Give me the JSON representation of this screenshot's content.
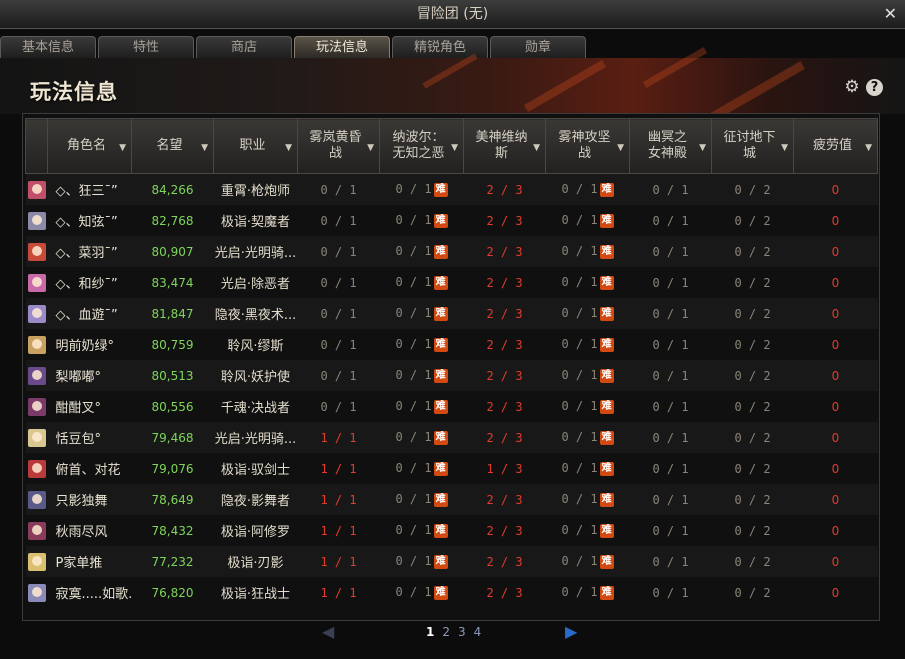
{
  "window": {
    "title": "冒险团 (无)",
    "close_glyph": "✕"
  },
  "tabs": [
    {
      "label": "基本信息",
      "active": false
    },
    {
      "label": "特性",
      "active": false
    },
    {
      "label": "商店",
      "active": false
    },
    {
      "label": "玩法信息",
      "active": true
    },
    {
      "label": "精锐角色",
      "active": false
    },
    {
      "label": "勋章",
      "active": false
    }
  ],
  "section": {
    "title": "玩法信息",
    "gear_icon": "⚙",
    "help_icon": "?"
  },
  "columns": [
    {
      "label": "",
      "sortable": false
    },
    {
      "label": "角色名",
      "sortable": true
    },
    {
      "label": "名望",
      "sortable": true
    },
    {
      "label": "职业",
      "sortable": true
    },
    {
      "label": "雾岚黄昏\n战",
      "sortable": true
    },
    {
      "label": "纳波尔：\n无知之恶",
      "sortable": true
    },
    {
      "label": "美神维纳\n斯",
      "sortable": true
    },
    {
      "label": "雾神攻坚\n战",
      "sortable": true
    },
    {
      "label": "幽冥之\n女神殿",
      "sortable": true
    },
    {
      "label": "征讨地下\n城",
      "sortable": true
    },
    {
      "label": "疲劳值",
      "sortable": true
    }
  ],
  "badge_text": "难",
  "rows": [
    {
      "avatar_color": "#c0506a",
      "name": "◇、狂三ˉ”",
      "fame": "84,266",
      "job": "重霄·枪炮师",
      "c1": "0 / 1",
      "c1_red": false,
      "c2": "0 / 1",
      "c3": "2 / 3",
      "c4": "0 / 1",
      "c5": "0 / 1",
      "c6": "0 / 2",
      "fatigue": "0"
    },
    {
      "avatar_color": "#8a8aa8",
      "name": "◇、知弦ˉ”",
      "fame": "82,768",
      "job": "极诣·契魔者",
      "c1": "0 / 1",
      "c1_red": false,
      "c2": "0 / 1",
      "c3": "2 / 3",
      "c4": "0 / 1",
      "c5": "0 / 1",
      "c6": "0 / 2",
      "fatigue": "0"
    },
    {
      "avatar_color": "#c84a3a",
      "name": "◇、菜羽ˉ”",
      "fame": "80,907",
      "job": "光启·光明骑...",
      "c1": "0 / 1",
      "c1_red": false,
      "c2": "0 / 1",
      "c3": "2 / 3",
      "c4": "0 / 1",
      "c5": "0 / 1",
      "c6": "0 / 2",
      "fatigue": "0"
    },
    {
      "avatar_color": "#c86aa8",
      "name": "◇、和纱ˉ”",
      "fame": "83,474",
      "job": "光启·除恶者",
      "c1": "0 / 1",
      "c1_red": false,
      "c2": "0 / 1",
      "c3": "2 / 3",
      "c4": "0 / 1",
      "c5": "0 / 1",
      "c6": "0 / 2",
      "fatigue": "0"
    },
    {
      "avatar_color": "#9a8ac8",
      "name": "◇、血遊ˉ”",
      "fame": "81,847",
      "job": "隐夜·黑夜术...",
      "c1": "0 / 1",
      "c1_red": false,
      "c2": "0 / 1",
      "c3": "2 / 3",
      "c4": "0 / 1",
      "c5": "0 / 1",
      "c6": "0 / 2",
      "fatigue": "0"
    },
    {
      "avatar_color": "#c8a060",
      "name": "明前奶绿°",
      "fame": "80,759",
      "job": "聆风·缪斯",
      "c1": "0 / 1",
      "c1_red": false,
      "c2": "0 / 1",
      "c3": "2 / 3",
      "c4": "0 / 1",
      "c5": "0 / 1",
      "c6": "0 / 2",
      "fatigue": "0"
    },
    {
      "avatar_color": "#6a4a8a",
      "name": "梨嘟嘟°",
      "fame": "80,513",
      "job": "聆风·妖护使",
      "c1": "0 / 1",
      "c1_red": false,
      "c2": "0 / 1",
      "c3": "2 / 3",
      "c4": "0 / 1",
      "c5": "0 / 1",
      "c6": "0 / 2",
      "fatigue": "0"
    },
    {
      "avatar_color": "#7a3a6a",
      "name": "酣酣叉°",
      "fame": "80,556",
      "job": "千魂·决战者",
      "c1": "0 / 1",
      "c1_red": false,
      "c2": "0 / 1",
      "c3": "2 / 3",
      "c4": "0 / 1",
      "c5": "0 / 1",
      "c6": "0 / 2",
      "fatigue": "0"
    },
    {
      "avatar_color": "#d8c890",
      "name": "恬豆包°",
      "fame": "79,468",
      "job": "光启·光明骑...",
      "c1": "1 / 1",
      "c1_red": true,
      "c2": "0 / 1",
      "c3": "2 / 3",
      "c4": "0 / 1",
      "c5": "0 / 1",
      "c6": "0 / 2",
      "fatigue": "0"
    },
    {
      "avatar_color": "#b83a3a",
      "name": "俯首、对花",
      "fame": "79,076",
      "job": "极诣·驭剑士",
      "c1": "1 / 1",
      "c1_red": true,
      "c2": "0 / 1",
      "c3": "1 / 3",
      "c4": "0 / 1",
      "c5": "0 / 1",
      "c6": "0 / 2",
      "fatigue": "0"
    },
    {
      "avatar_color": "#5a5a8a",
      "name": "只影独舞",
      "fame": "78,649",
      "job": "隐夜·影舞者",
      "c1": "1 / 1",
      "c1_red": true,
      "c2": "0 / 1",
      "c3": "2 / 3",
      "c4": "0 / 1",
      "c5": "0 / 1",
      "c6": "0 / 2",
      "fatigue": "0"
    },
    {
      "avatar_color": "#8a3a5a",
      "name": "秋雨尽风",
      "fame": "78,432",
      "job": "极诣·阿修罗",
      "c1": "1 / 1",
      "c1_red": true,
      "c2": "0 / 1",
      "c3": "2 / 3",
      "c4": "0 / 1",
      "c5": "0 / 1",
      "c6": "0 / 2",
      "fatigue": "0"
    },
    {
      "avatar_color": "#d8c070",
      "name": "P家单推",
      "fame": "77,232",
      "job": "极诣·刃影",
      "c1": "1 / 1",
      "c1_red": true,
      "c2": "0 / 1",
      "c3": "2 / 3",
      "c4": "0 / 1",
      "c5": "0 / 1",
      "c6": "0 / 2",
      "fatigue": "0"
    },
    {
      "avatar_color": "#8a8ab8",
      "name": "寂寞.....如歌...",
      "fame": "76,820",
      "job": "极诣·狂战士",
      "c1": "1 / 1",
      "c1_red": true,
      "c2": "0 / 1",
      "c3": "2 / 3",
      "c4": "0 / 1",
      "c5": "0 / 1",
      "c6": "0 / 2",
      "fatigue": "0"
    }
  ],
  "pagination": {
    "prev_icon": "◀",
    "next_icon": "▶",
    "pages": [
      "1",
      "2",
      "3",
      "4"
    ],
    "current": "1"
  }
}
